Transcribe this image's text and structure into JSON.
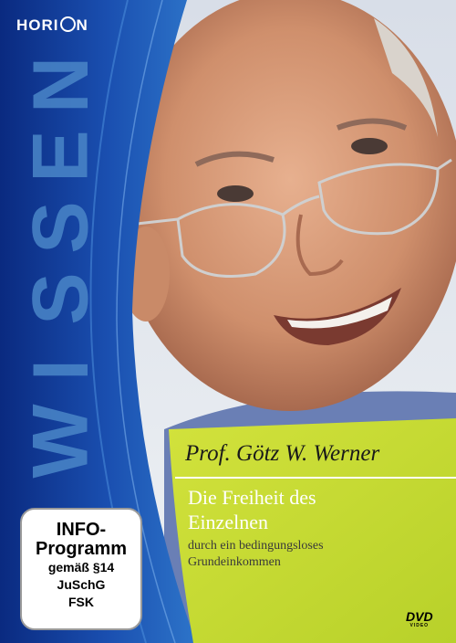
{
  "brand": {
    "logo": "HORIZON",
    "logo_pre": "HORI",
    "logo_post": "N"
  },
  "series_letters": [
    "W",
    "I",
    "S",
    "S",
    "E",
    "N"
  ],
  "author": "Prof. Götz W. Werner",
  "title_line1": "Die Freiheit des",
  "title_line2": "Einzelnen",
  "subtitle_line1": "durch ein bedingungsloses",
  "subtitle_line2": "Grundeinkommen",
  "rating": {
    "line1": "INFO-",
    "line2": "Programm",
    "line3": "gemäß §14",
    "line4": "JuSchG",
    "line5": "FSK"
  },
  "format": {
    "label": "DVD",
    "sub": "VIDEO"
  },
  "colors": {
    "band_blue": "#0d2f86",
    "band_light": "#2a6fc4",
    "lime": "#c8dc32",
    "text_dark": "#1a1a1a"
  }
}
